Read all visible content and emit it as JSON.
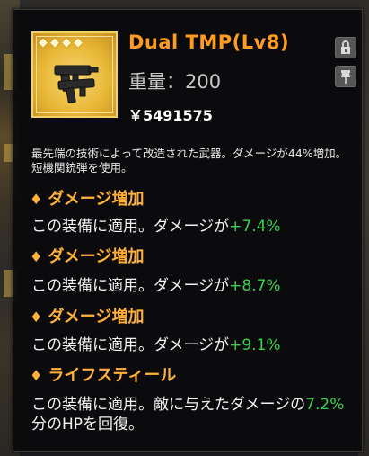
{
  "item": {
    "name": "Dual TMP(Lv8)",
    "weight": "重量：200",
    "price": "￥5491575",
    "description_line1": "最先端の技術によって改造された武器。ダメージが44%増加。",
    "description_line2": "短機関銃弾を使用。",
    "stars": [
      "◆",
      "◆",
      "◆",
      "◆"
    ]
  },
  "buttons": {
    "lock_icon": "lock-icon",
    "pin_icon": "pin-icon"
  },
  "stats": [
    {
      "title": "ダメージ増加",
      "prefix": "この装備に適用。ダメージが",
      "value": "+7.4%"
    },
    {
      "title": "ダメージ増加",
      "prefix": "この装備に適用。ダメージが",
      "value": "+8.7%"
    },
    {
      "title": "ダメージ増加",
      "prefix": "この装備に適用。ダメージが",
      "value": "+9.1%"
    },
    {
      "title": "ライフスティール",
      "prefix": "この装備に適用。敵に与えたダメージの",
      "value": "7.2%",
      "line2": "分のHPを回復。"
    }
  ],
  "colors": {
    "accent_orange": "#ff9b1f",
    "stat_title": "#ffb13a",
    "green_value": "#39d24a",
    "panel_bg": "#0a0a0c"
  }
}
